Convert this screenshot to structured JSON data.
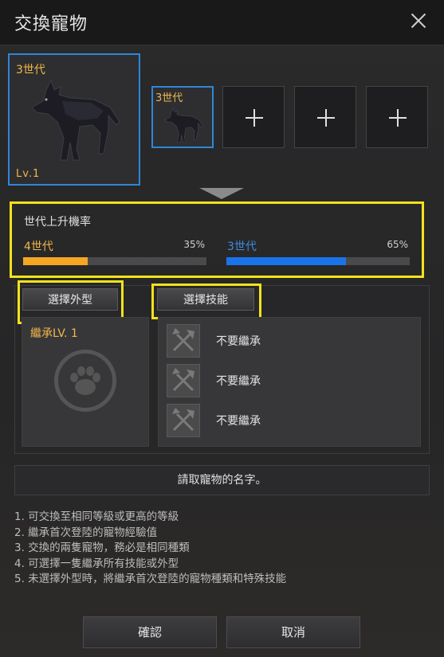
{
  "window": {
    "title": "交換寵物"
  },
  "pets": {
    "main": {
      "generation": "3世代",
      "level": "Lv.1"
    },
    "secondary": {
      "generation": "3世代"
    },
    "empty_slots": 3
  },
  "rate": {
    "title": "世代上升機率",
    "options": [
      {
        "label": "4世代",
        "percent_text": "35%",
        "percent": 35,
        "color": "#f5a623"
      },
      {
        "label": "3世代",
        "percent_text": "65%",
        "percent": 65,
        "color": "#1a73e8"
      }
    ]
  },
  "buttons": {
    "select_appearance": "選擇外型",
    "select_skill": "選擇技能",
    "confirm": "確認",
    "cancel": "取消"
  },
  "appearance": {
    "inherit_label": "繼承LV. 1",
    "icon": "paw-icon"
  },
  "skills": [
    {
      "label": "不要繼承",
      "icon": "axe-skill-icon"
    },
    {
      "label": "不要繼承",
      "icon": "axe-skill-icon"
    },
    {
      "label": "不要繼承",
      "icon": "axe-skill-icon"
    }
  ],
  "name_input": {
    "placeholder": "請取寵物的名字。"
  },
  "notes": [
    "1. 可交換至相同等級或更高的等級",
    "2. 繼承首次登陸的寵物經驗值",
    "3. 交換的兩隻寵物，務必是相同種類",
    "4. 可選擇一隻繼承所有技能或外型",
    "5. 未選擇外型時，將繼承首次登陸的寵物種類和特殊技能"
  ],
  "colors": {
    "highlight": "#f3e21b",
    "selected_border": "#2f87d6",
    "gen_text": "#f0b74a"
  }
}
